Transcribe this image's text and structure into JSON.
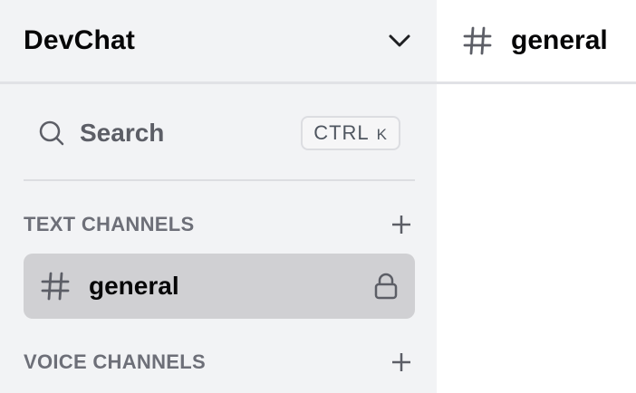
{
  "server": {
    "name": "DevChat",
    "dropdown_icon": "chevron-down-icon"
  },
  "search": {
    "label": "Search",
    "shortcut_ctrl": "CTRL",
    "shortcut_key": "K",
    "icon": "search-icon"
  },
  "categories": [
    {
      "label": "TEXT CHANNELS",
      "add_icon": "plus-icon"
    },
    {
      "label": "VOICE CHANNELS",
      "add_icon": "plus-icon"
    }
  ],
  "channels": [
    {
      "name": "general",
      "icon": "hash-icon",
      "status_icon": "lock-icon",
      "selected": true
    }
  ],
  "main_header": {
    "channel_name": "general",
    "icon": "hash-icon"
  },
  "colors": {
    "sidebar_bg": "#f2f3f5",
    "selected_channel_bg": "#d0d0d3",
    "text_primary": "#060607",
    "text_muted": "#6d6f78"
  }
}
